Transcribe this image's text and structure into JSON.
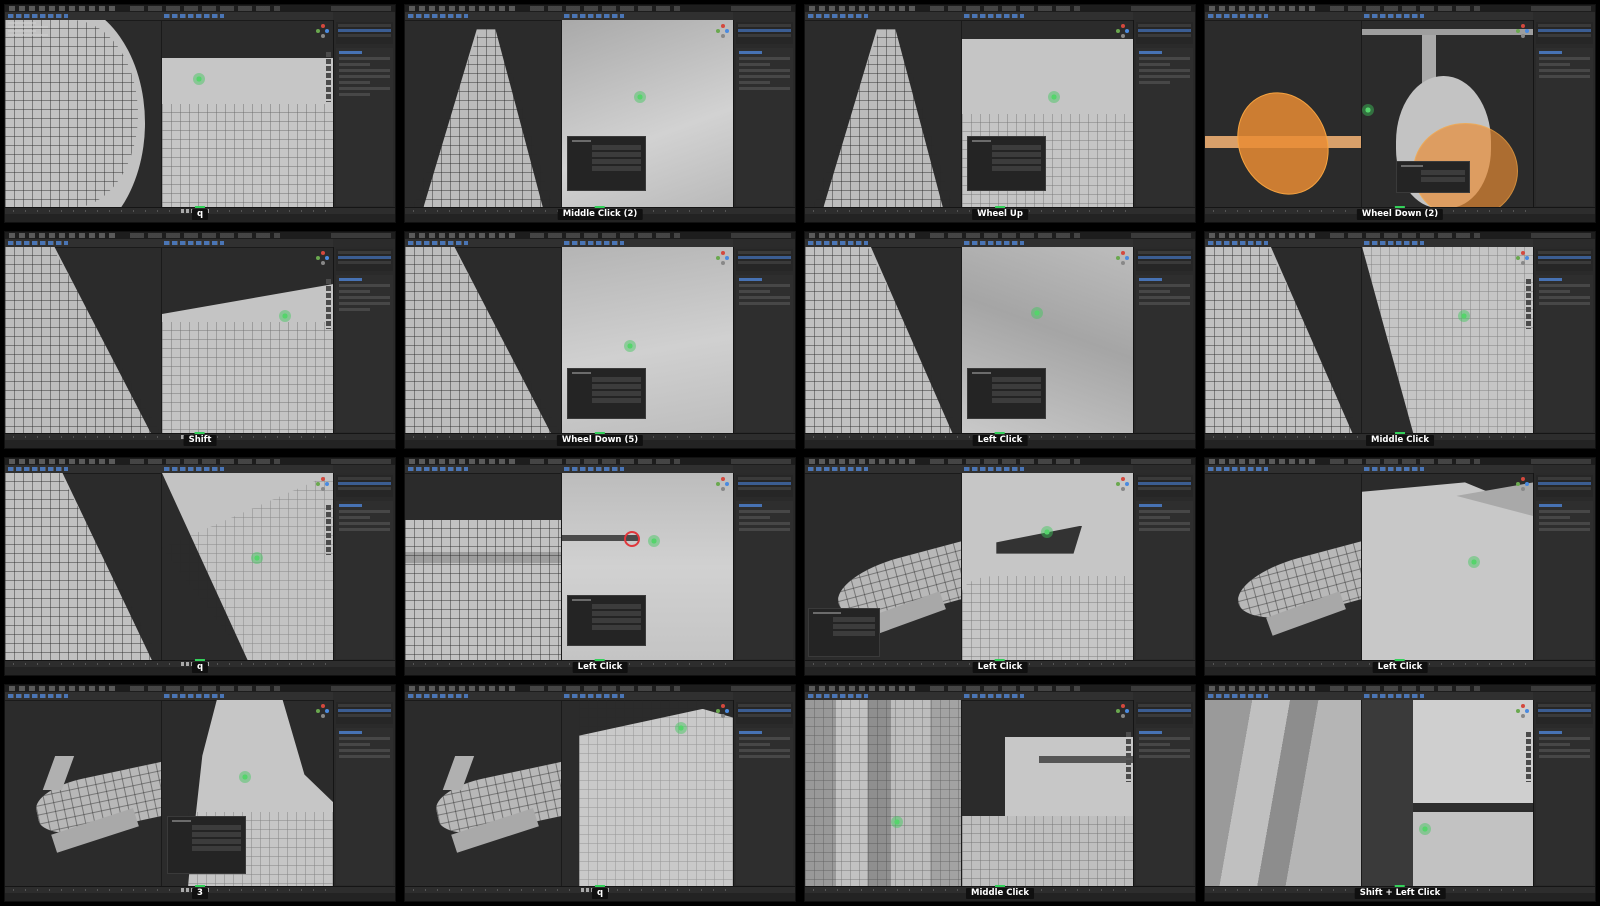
{
  "tiles": [
    {
      "caption": "q"
    },
    {
      "caption": "Middle Click (2)"
    },
    {
      "caption": "Wheel Up"
    },
    {
      "caption": "Wheel Down (2)"
    },
    {
      "caption": "Shift"
    },
    {
      "caption": "Wheel Down (5)"
    },
    {
      "caption": "Left Click"
    },
    {
      "caption": "Middle Click"
    },
    {
      "caption": "q"
    },
    {
      "caption": "Left Click"
    },
    {
      "caption": "Left Click"
    },
    {
      "caption": "Left Click"
    },
    {
      "caption": "3"
    },
    {
      "caption": "q"
    },
    {
      "caption": "Middle Click"
    },
    {
      "caption": "Shift + Left Click"
    }
  ],
  "colors": {
    "ui_background": "#2b2b2b",
    "mesh_grey": "#bdbdbd",
    "selection_orange": "#f7a440",
    "cursor_green": "#55d46b",
    "cursor_red": "#e0363b",
    "caption_bg": "#101010"
  }
}
